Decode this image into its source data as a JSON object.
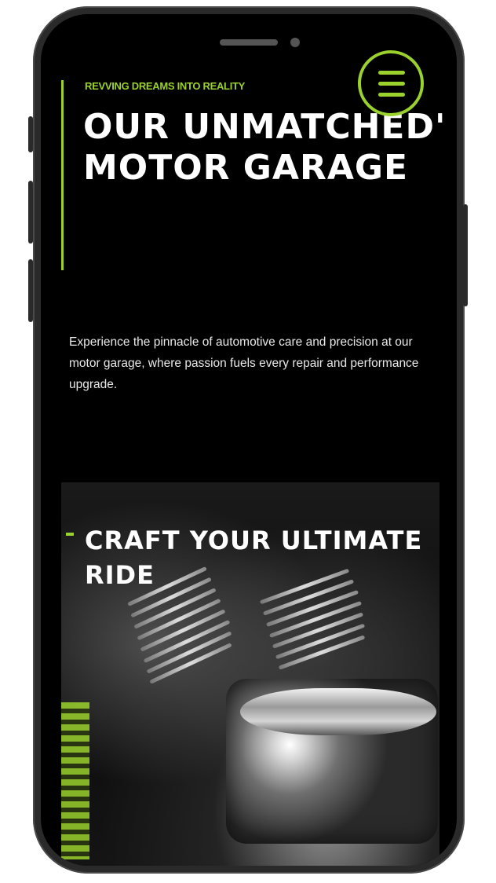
{
  "hero": {
    "tagline": "REVVING DREAMS INTO REALITY",
    "headline": "OUR UNMATCHED' MOTOR GARAGE",
    "intro": "Experience the pinnacle of automotive care and precision at our motor garage, where passion fuels every repair and performance upgrade."
  },
  "section": {
    "title": "CRAFT YOUR ULTIMATE RIDE"
  },
  "menu": {
    "icon": "hamburger-menu-icon"
  },
  "colors": {
    "accent": "#9bd12c",
    "background": "#000000",
    "text": "#ffffff"
  }
}
